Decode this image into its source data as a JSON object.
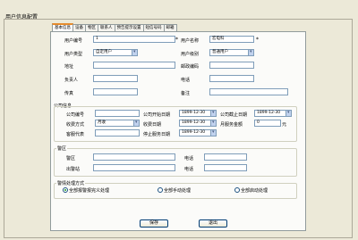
{
  "window_title": "用户信息配置",
  "tabs": [
    "基本信息",
    "设备",
    "物区",
    "联系人",
    "预告提示设置",
    "短信号码",
    "邮箱"
  ],
  "basic": {
    "user_no_label": "用户编号",
    "user_no_value": "1",
    "user_name_label": "用户名称",
    "user_name_value": "宏电科",
    "user_type_label": "用户类型",
    "user_type_value": "自定用户",
    "user_level_label": "用户级别",
    "user_level_value": "普通用户",
    "address_label": "地址",
    "postcode_label": "邮政编码",
    "contact_label": "负责人",
    "phone_label": "电话",
    "fax_label": "传真",
    "remark_label": "备注"
  },
  "company": {
    "section_label": "公司信息",
    "company_no_label": "公司编号",
    "start_date_label": "公司开始日期",
    "start_date_value": "1899-12-30",
    "end_date_label": "公司截止日期",
    "end_date_value": "1899-12-30",
    "fee_method_label": "收费方式",
    "fee_method_value": "月收",
    "fee_date_label": "收费日期",
    "fee_date_value": "1899-12-30",
    "fee_amount_label": "月服务金额",
    "fee_amount_value": "0",
    "fee_unit": "元",
    "manager_label": "客服代表",
    "stop_date_label": "停止服务日期",
    "stop_date_value": "1899-12-30"
  },
  "alarm_section": {
    "title": "警区",
    "area_label": "警区",
    "area_phone_label": "电话",
    "station_label": "出警站",
    "station_phone_label": "电话"
  },
  "handling": {
    "title": "警情处理方式",
    "options": [
      "全部报警报完义处理",
      "全部手动处理",
      "全部启动处理"
    ],
    "selected": 0
  },
  "buttons": {
    "save": "保存",
    "exit": "退出"
  },
  "required_mark": "*"
}
